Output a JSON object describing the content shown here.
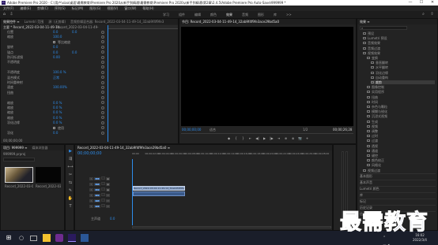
{
  "titlebar": {
    "app_icon": "Pr",
    "title": "Adobe Premiere Pro 2020 - C:\\用户\\xiao\\桌面\\最需教育\\Premiere Pro 2020从新手到精通\\最需教育\\Premiere Pro 2020从新手到精通\\第2章\\2.4.5\\Adobe Premiere Pro Auto-Save\\999999 *",
    "minimize": "—",
    "maximize": "☐",
    "close": "✕"
  },
  "menu": [
    "文件(F)",
    "编辑(E)",
    "剪辑(C)",
    "序列(S)",
    "标记(M)",
    "图形(G)",
    "视图(V)",
    "窗口(W)",
    "帮助(H)"
  ],
  "workspace_tabs": [
    {
      "label": "学习",
      "active": false
    },
    {
      "label": "组件",
      "active": false
    },
    {
      "label": "编辑",
      "active": false
    },
    {
      "label": "颜色",
      "active": false
    },
    {
      "label": "效果",
      "active": true
    },
    {
      "label": "音频",
      "active": false
    },
    {
      "label": "图形",
      "active": false
    },
    {
      "label": "库",
      "active": false
    },
    {
      "label": ">>",
      "active": false
    }
  ],
  "effect_controls": {
    "tabs": [
      {
        "label": "效果控件 ≡",
        "active": true
      },
      {
        "label": "Lumetri 范围",
        "active": false
      },
      {
        "label": "源: (无剪辑)",
        "active": false
      },
      {
        "label": "音频剪辑混合器: Record_2022-03-04-11-49-14_32ab9f4f9fe3",
        "active": false
      }
    ],
    "header_clip": "主要 * Record_2022-03-04-11-49-14...",
    "header_seq": "Record_2022-03-04-11-49-14_32ab9f4f9fe3ace29bd5a0",
    "rows": [
      {
        "label": "位置",
        "value": "0.0",
        "value2": "0.0"
      },
      {
        "label": "缩放",
        "value": "100.0"
      },
      {
        "label": "",
        "value": "",
        "checkbox": "等比缩放"
      },
      {
        "label": "旋转",
        "value": "0.0"
      },
      {
        "label": "锚点",
        "value": "0.0",
        "value2": "0.0"
      },
      {
        "label": "防闪烁滤镜",
        "value": "0.00"
      },
      {
        "label": "不透明度",
        "value": ""
      },
      {
        "label": "",
        "value": ""
      },
      {
        "label": "不透明度",
        "value": "100.0 %"
      },
      {
        "label": "混合模式",
        "value": "正常"
      },
      {
        "label": "时间重映射",
        "value": ""
      },
      {
        "label": "速度",
        "value": "100.00%"
      },
      {
        "label": "扭曲",
        "value": ""
      },
      {
        "label": "",
        "value": ""
      },
      {
        "label": "缩放",
        "value": "0.0 %"
      },
      {
        "label": "缩放",
        "value": "0.0 %"
      },
      {
        "label": "缩放",
        "value": "0.0 %"
      },
      {
        "label": "缩放",
        "value": "0.0 %"
      },
      {
        "label": "羽化边缘",
        "value": "0.0 %"
      },
      {
        "label": "",
        "value": "",
        "checkbox": "使用"
      },
      {
        "label": "羽化",
        "value": "0.0"
      }
    ],
    "timecode": "00;00;00;00"
  },
  "program": {
    "tab": "节目: Record_2022-03-04-11-49-14_32ab9f4f9fe3ace29bd5a0",
    "timecode_left": "00;00;00;00",
    "fit": "适合",
    "scale": "1/2",
    "timecode_right": "00;00;26;28",
    "controls": [
      "◆",
      "{",
      "}",
      "⇤",
      "◀|",
      "▶",
      "|▶",
      "⇥",
      "⊕",
      "⊗",
      "📷",
      "+"
    ]
  },
  "effects_panel": {
    "tab": "效果 ≡",
    "items": [
      {
        "label": "预设",
        "indent": 1
      },
      {
        "label": "Lumetri 预设",
        "indent": 1
      },
      {
        "label": "音频效果",
        "indent": 1
      },
      {
        "label": "音频过渡",
        "indent": 1
      },
      {
        "label": "视频效果",
        "indent": 1
      },
      {
        "label": "变换",
        "indent": 2
      },
      {
        "label": "垂直翻转",
        "indent": 3
      },
      {
        "label": "水平翻转",
        "indent": 3
      },
      {
        "label": "羽化边缘",
        "indent": 3
      },
      {
        "label": "自动重构",
        "indent": 3
      },
      {
        "label": "裁剪",
        "indent": 3,
        "selected": true
      },
      {
        "label": "图像控制",
        "indent": 2
      },
      {
        "label": "实用程序",
        "indent": 2
      },
      {
        "label": "扭曲",
        "indent": 2
      },
      {
        "label": "时间",
        "indent": 2
      },
      {
        "label": "杂色与颗粒",
        "indent": 2
      },
      {
        "label": "模糊与锐化",
        "indent": 2
      },
      {
        "label": "沉浸式视频",
        "indent": 2
      },
      {
        "label": "生成",
        "indent": 2
      },
      {
        "label": "视频",
        "indent": 2
      },
      {
        "label": "调整",
        "indent": 2
      },
      {
        "label": "过时",
        "indent": 2
      },
      {
        "label": "过渡",
        "indent": 2
      },
      {
        "label": "透视",
        "indent": 2
      },
      {
        "label": "通道",
        "indent": 2
      },
      {
        "label": "键控",
        "indent": 2
      },
      {
        "label": "颜色校正",
        "indent": 2
      },
      {
        "label": "风格化",
        "indent": 2
      },
      {
        "label": "视频过渡",
        "indent": 1
      }
    ],
    "sub_panels": [
      "基本图形",
      "基本声音",
      "Lumetri 颜色",
      "库",
      "标记",
      "历史记录",
      "信息"
    ]
  },
  "project": {
    "tabs": [
      {
        "label": "项目: 999999 ≡",
        "active": true
      },
      {
        "label": "媒体浏览器",
        "active": false
      }
    ],
    "path": "999999.prproj",
    "items": [
      {
        "name": "Record_2022-03-04-11...",
        "meta": "26;28"
      },
      {
        "name": "Record_2022-03-04-...",
        "meta": "26;28"
      }
    ]
  },
  "timeline": {
    "tab": "Record_2022-03-04-11-49-14_32ab9f4f9fe3ace29bd5a0 ≡",
    "timecode": "00;00;00;00",
    "ruler": [
      "00;00",
      "00;00;02;00",
      "00;00;04;00",
      "00;00;06;00",
      "00;00;08;00",
      "00;00;10;00",
      "00;00;12;00",
      "00;00;14;00",
      "00;00;16;00",
      "00;00;18;00",
      "00;00;20;00",
      "00;00;22;00",
      "00;00;24;00",
      "00;00;26;00",
      "00;00;28;00"
    ],
    "tracks": [
      {
        "name": "V3",
        "lock": "6",
        "eye": "●"
      },
      {
        "name": "V2",
        "lock": "6",
        "eye": "●"
      },
      {
        "name": "V1",
        "lock": "6",
        "eye": "●"
      },
      {
        "name": "A1",
        "lock": "6",
        "eye": "M"
      },
      {
        "name": "A2",
        "lock": "6",
        "eye": "M"
      },
      {
        "name": "A3",
        "lock": "6",
        "eye": "M"
      }
    ],
    "master": "主声道",
    "master_value": "0.0",
    "video_clip": "Record_2022-03-04-11-49-14_32ab9f4f9fe3ace29bd5a0[V]",
    "tools": [
      "▶",
      "⇶",
      "⟷",
      "✂",
      "⇆",
      "✎",
      "✋",
      "T"
    ]
  },
  "taskbar": {
    "start": "⊞",
    "search": "○",
    "time": "16:02",
    "date": "2022/3/4"
  },
  "watermark": "最需教育",
  "colors": {
    "accent": "#2d8ceb",
    "panel": "#232323",
    "background": "#1d1d1d",
    "clip_video": "#8fa6c8",
    "clip_audio": "#3a5a8a"
  }
}
